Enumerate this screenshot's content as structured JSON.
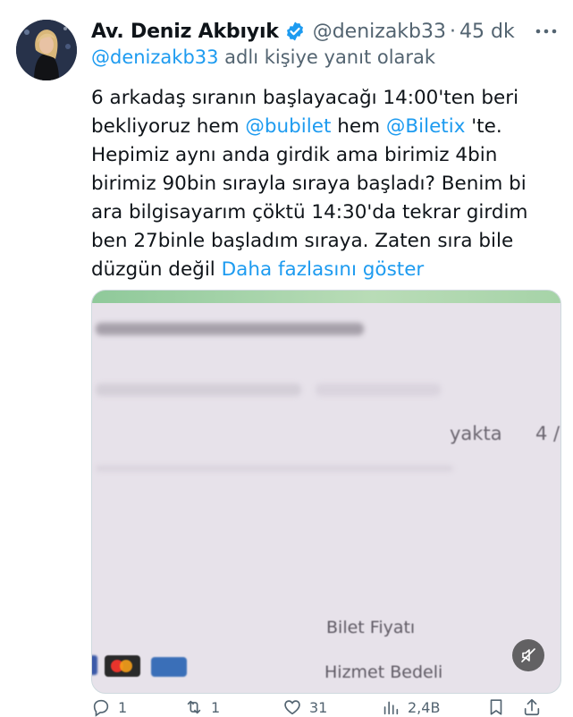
{
  "tweet": {
    "author_name": "Av. Deniz Akbıyık",
    "handle": "@denizakb33",
    "separator": "·",
    "time": "45 dk",
    "reply_mention": "@denizakb33",
    "reply_suffix": " adlı kişiye yanıt olarak",
    "text_lines": [
      "6 arkadaş sıranın başlayacağı 14:00'ten beri",
      "bekliyoruz hem ",
      "Hepimiz aynı anda girdik ama birimiz 4bin",
      "birimiz 90bin sırayla sıraya başladı? Benim bi",
      "ara bilgisayarım çöktü 14:30'da tekrar girdim",
      "ben 27binle başladım sıraya. Zaten sıra bile",
      "düzgün değil "
    ],
    "mention_bubilet": "@bubilet",
    "text_hem": " hem ",
    "mention_biletix": "@Biletix",
    "text_te": " 'te.",
    "show_more": "Daha fazlasını göster"
  },
  "media": {
    "text_yakta": "yakta",
    "text_four": "4 /",
    "text_bilet_fiyati": "Bilet Fiyatı",
    "text_hizmet_bedeli": "Hizmet Bedeli"
  },
  "actions": {
    "reply_count": "1",
    "retweet_count": "1",
    "like_count": "31",
    "views_count": "2,4B"
  },
  "colors": {
    "accent": "#1d9bf0",
    "secondary_text": "#536471",
    "verified": "#1d9bf0"
  }
}
